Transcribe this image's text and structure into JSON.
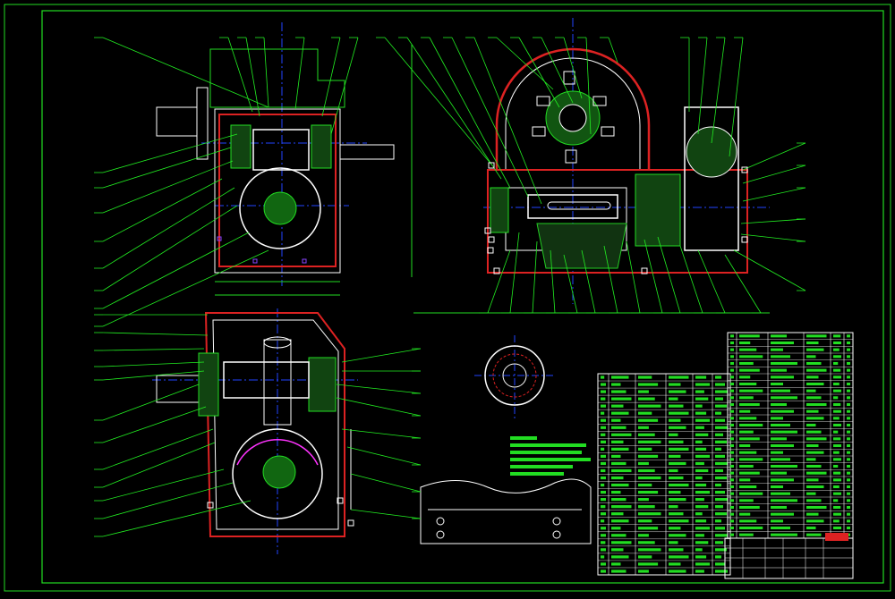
{
  "drawing": {
    "background": "#000000",
    "colors": {
      "frame": "#22dd22",
      "outline": "#ffffff",
      "housing": "#dd2222",
      "center": "#2244ff",
      "hatch": "#22cc22",
      "bolt": "#8844ff",
      "accent": "#ff33ff",
      "leader": "#22ee22"
    },
    "title_stamp": "",
    "views": [
      {
        "name": "top-left-section-view"
      },
      {
        "name": "top-right-section-view"
      },
      {
        "name": "bottom-left-section-view"
      },
      {
        "name": "flange-detail-view"
      },
      {
        "name": "broken-plate-detail-view"
      }
    ]
  }
}
